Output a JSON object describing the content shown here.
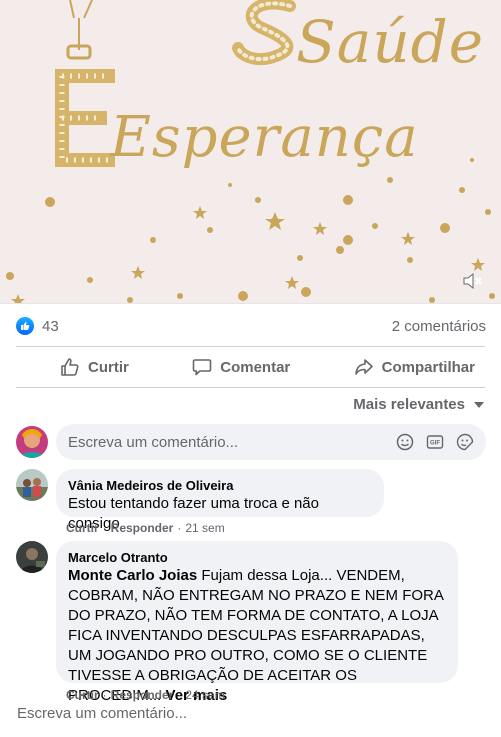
{
  "post": {
    "image_words": {
      "line1": "Saúde",
      "line2": "Esperança"
    },
    "icons": {
      "volume": "volume-off-icon"
    }
  },
  "stats": {
    "like_count": "43",
    "comment_count": "2 comentários",
    "colors": {
      "like_blue": "#0866ff"
    }
  },
  "actions": {
    "like": "Curtir",
    "comment": "Comentar",
    "share": "Compartilhar"
  },
  "sort": {
    "label": "Mais relevantes"
  },
  "composer": {
    "placeholder": "Escreva um comentário..."
  },
  "comments": [
    {
      "author": "Vânia Medeiros de Oliveira",
      "text": "Estou tentando fazer uma troca e não consigo",
      "like": "Curtir",
      "reply": "Responder",
      "time": "21 sem"
    },
    {
      "author": "Marcelo Otranto",
      "mention": "Monte Carlo Joias",
      "text": "Fujam dessa Loja... VENDEM, COBRAM, NÃO ENTREGAM NO PRAZO E NEM FORA DO PRAZO, NÃO TEM FORMA DE CONTATO, A LOJA FICA INVENTANDO DESCULPAS ESFARRAPADAS, UM JOGANDO PRO OUTRO, COMO SE O CLIENTE TIVESSE A OBRIGAÇÃO DE ACEITAR OS PROCEDIM...",
      "see_more": "Ver mais",
      "like": "Curtir",
      "reply": "Responder",
      "time": "24 sem"
    }
  ],
  "bottom_prompt": "Escreva um comentário..."
}
